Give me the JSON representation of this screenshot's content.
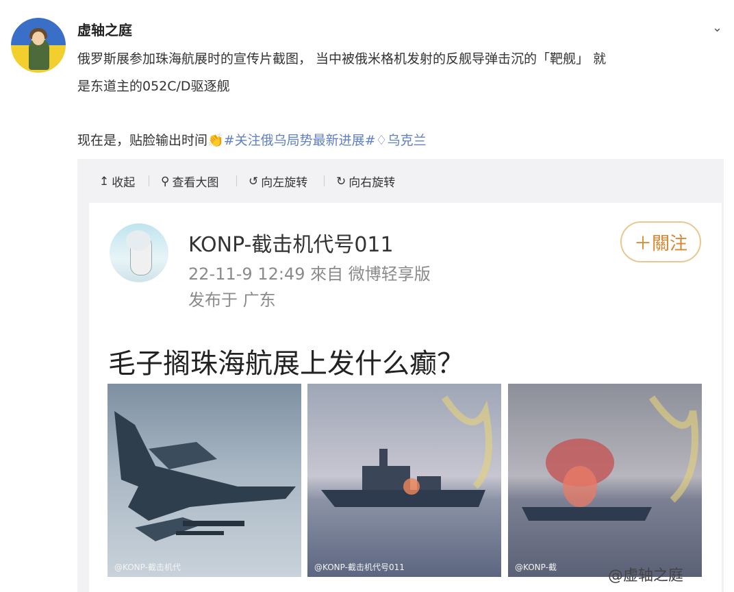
{
  "post": {
    "username": "虚轴之庭",
    "text_line1": "俄罗斯展参加珠海航展时的宣传片截图， 当中被俄米格机发射的反舰导弹击沉的「靶舰」 就",
    "text_line2": "是东道主的052C/D驱逐舰",
    "text_prefix": "现在是，贴脸输出时间",
    "emoji": "👏",
    "tag1": "#关注俄乌局势最新进展#",
    "tag2": "乌克兰"
  },
  "toolbar": {
    "collapse": "收起",
    "view_large": "查看大图",
    "rotate_left": "向左旋转",
    "rotate_right": "向右旋转"
  },
  "card": {
    "name": "KONP-截击机代号011",
    "meta": "22-11-9 12:49   來自 微博轻享版",
    "location": "发布于 广东",
    "follow": "＋關注",
    "headline": "毛子搁珠海航展上发什么癫？",
    "watermark1": "@KONP-截击机代",
    "watermark2": "@KONP-截击机代号011",
    "watermark3": "@KONP-截"
  },
  "page_watermark": "@虚轴之庭",
  "icons": {
    "collapse": "arrow-up-icon",
    "view_large": "magnifier-icon",
    "rotate_left": "rotate-left-icon",
    "rotate_right": "rotate-right-icon",
    "chevron": "chevron-down-icon"
  },
  "colors": {
    "tag": "#eb7350",
    "tag_blue": "#5f7fc6",
    "follow": "#d8862e"
  }
}
